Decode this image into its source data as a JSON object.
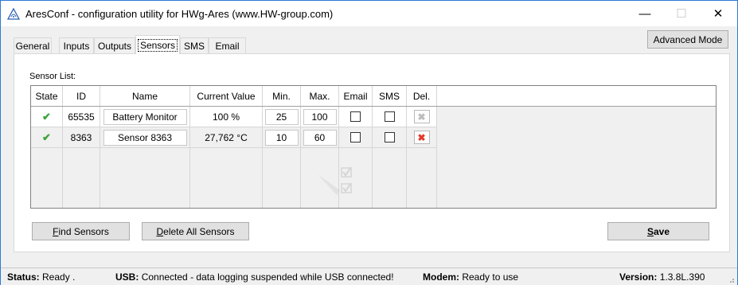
{
  "window": {
    "title": "AresConf - configuration utility for HWg-Ares (www.HW-group.com)",
    "controls": {
      "minimize": "—",
      "maximize": "☐",
      "close": "✕"
    }
  },
  "toolbar": {
    "advanced_mode_label": "Advanced Mode"
  },
  "tabs": [
    {
      "label": "General",
      "active": false
    },
    {
      "label": "Inputs",
      "active": false
    },
    {
      "label": "Outputs",
      "active": false
    },
    {
      "label": "Sensors",
      "active": true
    },
    {
      "label": "SMS",
      "active": false
    },
    {
      "label": "Email",
      "active": false
    }
  ],
  "sensor_list": {
    "label": "Sensor List:",
    "columns": [
      "State",
      "ID",
      "Name",
      "Current Value",
      "Min.",
      "Max.",
      "Email",
      "SMS",
      "Del."
    ],
    "rows": [
      {
        "state_icon": "green-check-icon",
        "id": "65535",
        "name": "Battery Monitor",
        "current_value": "100 %",
        "min": "25",
        "max": "100",
        "email": false,
        "sms": false,
        "delete_enabled": false
      },
      {
        "state_icon": "green-check-icon",
        "id": "8363",
        "name": "Sensor 8363",
        "current_value": "27,762 °C",
        "min": "10",
        "max": "60",
        "email": false,
        "sms": false,
        "delete_enabled": true
      }
    ]
  },
  "buttons": {
    "find_sensors_prefix": "",
    "find_sensors_u": "F",
    "find_sensors_rest": "ind Sensors",
    "delete_all_u": "D",
    "delete_all_rest": "elete All Sensors",
    "save_u": "S",
    "save_rest": "ave"
  },
  "status": {
    "status_label": "Status:",
    "status_value": "Ready .",
    "usb_label": "USB:",
    "usb_value": "Connected - data logging suspended while USB connected!",
    "modem_label": "Modem:",
    "modem_value": "Ready to use",
    "version_label": "Version:",
    "version_value": "1.3.8L.390"
  },
  "colors": {
    "window_border": "#2b79d8",
    "check_green": "#3da43a",
    "delete_red": "#e23a2a"
  }
}
